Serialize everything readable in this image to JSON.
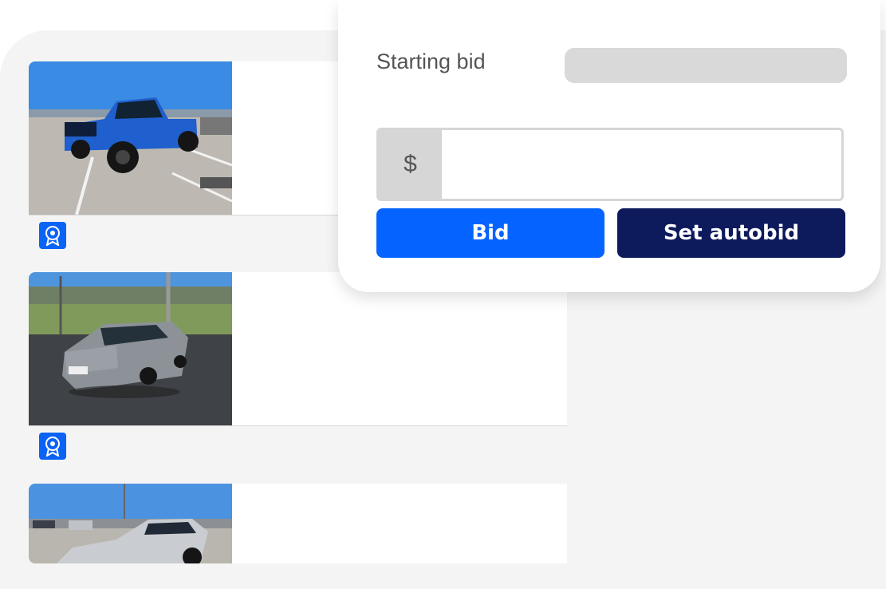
{
  "bid_panel": {
    "starting_bid_label": "Starting bid",
    "starting_bid_value": "",
    "currency_symbol": "$",
    "amount_value": "",
    "amount_placeholder": "",
    "bid_label": "Bid",
    "autobid_label": "Set autobid"
  },
  "listings": [
    {
      "vehicle": "blue pickup truck"
    },
    {
      "vehicle": "silver sedan"
    },
    {
      "vehicle": "silver hatchback"
    }
  ],
  "colors": {
    "primary_blue": "#0563ff",
    "navy": "#0d1a5c",
    "badge_blue": "#0b63f6"
  },
  "icons": {
    "badge": "award-badge-icon"
  }
}
